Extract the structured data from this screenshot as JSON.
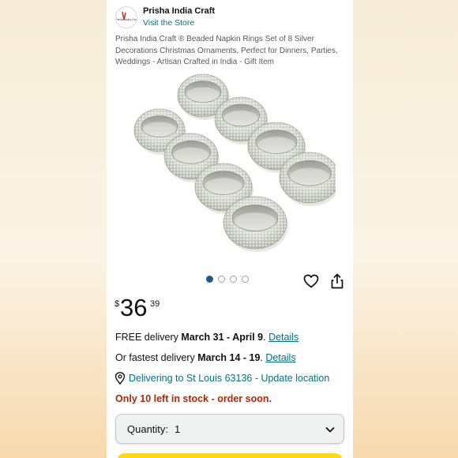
{
  "store": {
    "logo_text": "Prisha India Craft",
    "name": "Prisha India Craft",
    "visit_label": "Visit the Store"
  },
  "product": {
    "title": "Prisha India Craft ® Beaded Napkin Rings Set of 8 Silver Decorations Christmas Ornaments, Perfect for Dinners, Parties, Weddings - Artisan Crafted in India - Gift Item",
    "image_icon": "silver-beaded-napkin-rings-photo"
  },
  "gallery": {
    "dot_count": 4,
    "active_index": 0
  },
  "actions": {
    "wishlist_icon": "heart-icon",
    "share_icon": "share-icon"
  },
  "price": {
    "currency": "$",
    "whole": "36",
    "fraction": "39"
  },
  "delivery": {
    "free_prefix": "FREE delivery ",
    "free_dates": "March 31 - April 9",
    "free_suffix": ". ",
    "free_link": "Details",
    "fast_prefix": "Or fastest delivery ",
    "fast_dates": "March 14 - 19",
    "fast_suffix": ". ",
    "fast_link": "Details"
  },
  "location": {
    "icon": "location-pin-icon",
    "text": "Delivering to St Louis 63136 - Update location"
  },
  "stock": {
    "text": "Only 10 left in stock - order soon."
  },
  "quantity": {
    "label": "Quantity:",
    "value": "1"
  },
  "colors": {
    "link": "#007185",
    "stock_red": "#b12704",
    "buy_yellow": "#ffd814",
    "active_dot": "#1a5a96"
  }
}
